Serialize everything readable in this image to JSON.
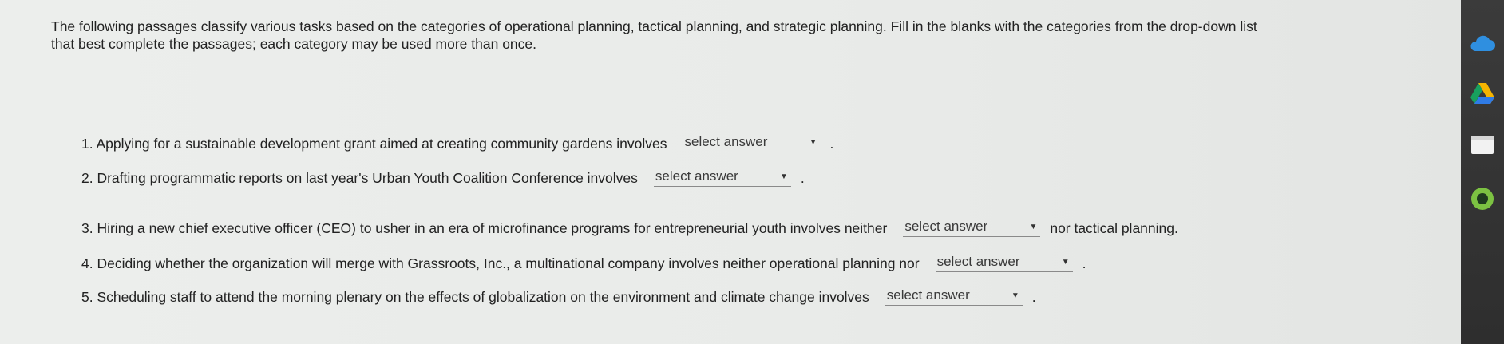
{
  "instructions": {
    "line1": "The following passages classify various tasks based on the categories of operational planning, tactical planning, and strategic planning. Fill in the blanks with the categories from the drop-down list",
    "line2": "that best complete the passages; each category may be used more than once."
  },
  "items": [
    {
      "before": "1. Applying for a sustainable development grant aimed at creating community gardens involves",
      "select": "select answer",
      "after": "."
    },
    {
      "before": "2. Drafting programmatic reports on last year's Urban Youth Coalition Conference involves",
      "select": "select answer",
      "after": "."
    },
    {
      "before": "3. Hiring a new chief executive officer (CEO) to usher in an era of microfinance programs for entrepreneurial youth involves neither",
      "select": "select answer",
      "after": "nor tactical planning."
    },
    {
      "before": "4. Deciding whether the organization will merge with Grassroots, Inc., a multinational company involves neither operational planning nor",
      "select": "select answer",
      "after": "."
    },
    {
      "before": "5. Scheduling staff to attend the morning plenary on the effects of globalization on the environment and climate change involves",
      "select": "select answer",
      "after": "."
    }
  ],
  "sidebar": {
    "icons": [
      "cloud-icon",
      "drive-icon",
      "notes-icon",
      "circle-app-icon"
    ]
  }
}
